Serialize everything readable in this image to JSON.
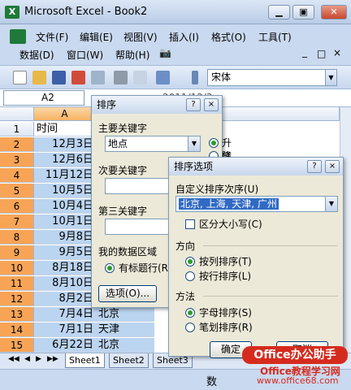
{
  "window": {
    "title": "Microsoft Excel - Book2",
    "app_icon": "X"
  },
  "menu": {
    "items": [
      "文件(F)",
      "编辑(E)",
      "视图(V)",
      "插入(I)",
      "格式(O)",
      "工具(T)",
      "数据(D)",
      "窗口(W)",
      "帮助(H)"
    ],
    "help_icon_glyph": "📷",
    "min": "▁",
    "restore": "▣",
    "close": "✕",
    "sub_min": "_",
    "sub_restore": "□",
    "sub_close": "×"
  },
  "toolbar": {
    "font_name": "宋体",
    "drop": "▼"
  },
  "formula": {
    "name_box": "A2",
    "content": "2011/12/3"
  },
  "grid": {
    "column_a": "A",
    "row_numbers": [
      "1",
      "2",
      "3",
      "4",
      "5",
      "6",
      "7",
      "8",
      "9",
      "10",
      "11",
      "12",
      "13",
      "14",
      "15"
    ],
    "col_a_values": [
      "时间",
      "12月3日",
      "12月6日",
      "11月12日",
      "10月5日",
      "10月4日",
      "10月1日",
      "9月8日",
      "9月5日",
      "8月18日",
      "8月10日",
      "8月2日",
      "7月4日",
      "7月1日",
      "6月22日"
    ],
    "col_b_values": [
      "",
      "",
      "",
      "",
      "",
      "",
      "",
      "",
      "",
      "",
      "",
      "",
      "北京",
      "天津",
      "北京"
    ]
  },
  "sheets": {
    "tabs": [
      "Sheet1",
      "Sheet2",
      "Sheet3"
    ],
    "nav": [
      "◀◀",
      "◀",
      "▶",
      "▶▶"
    ]
  },
  "status": {
    "text": "数"
  },
  "sort_dialog": {
    "title": "排序",
    "help": "?",
    "close": "×",
    "primary_key_label": "主要关键字",
    "primary_key_value": "地点",
    "asc_label": "升序(A)",
    "desc_label": "降序(D)",
    "secondary_key_label": "次要关键字",
    "tertiary_key_label": "第三关键字",
    "range_label": "我的数据区域",
    "has_header_label": "有标题行(R)",
    "options_button": "选项(O)..."
  },
  "options_dialog": {
    "title": "排序选项",
    "help": "?",
    "close": "×",
    "custom_order_label": "自定义排序次序(U)",
    "custom_order_value": "北京, 上海, 天津, 广州",
    "case_label": "区分大小写(C)",
    "direction_label": "方向",
    "by_column_label": "按列排序(T)",
    "by_row_label": "按行排序(L)",
    "method_label": "方法",
    "alpha_label": "字母排序(S)",
    "stroke_label": "笔划排序(R)",
    "ok_button": "确定",
    "cancel_button": "取消"
  },
  "watermark": {
    "line1": "Office办公助手",
    "line2": "Office教程学习网",
    "line3": "www.office68.com"
  }
}
